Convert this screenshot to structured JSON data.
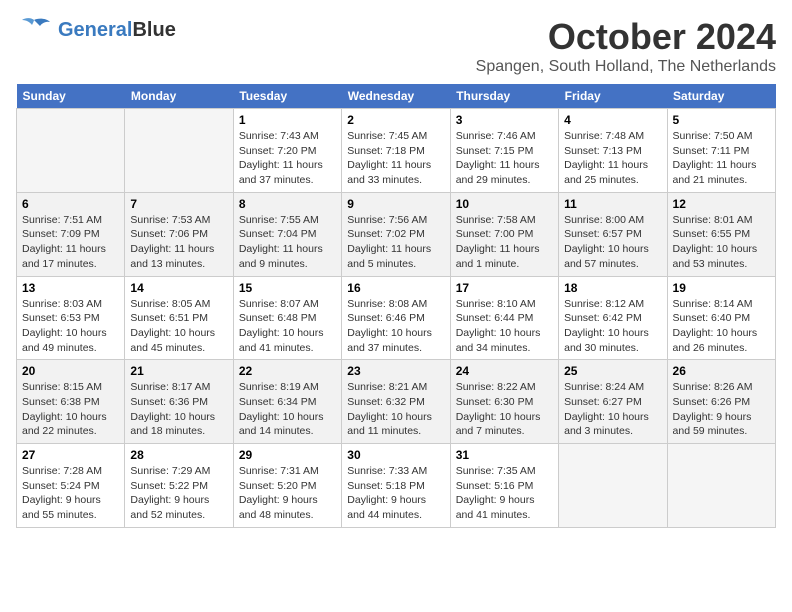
{
  "logo": {
    "part1": "General",
    "part2": "Blue"
  },
  "title": "October 2024",
  "location": "Spangen, South Holland, The Netherlands",
  "weekdays": [
    "Sunday",
    "Monday",
    "Tuesday",
    "Wednesday",
    "Thursday",
    "Friday",
    "Saturday"
  ],
  "weeks": [
    [
      {
        "day": "",
        "sunrise": "",
        "sunset": "",
        "daylight": ""
      },
      {
        "day": "",
        "sunrise": "",
        "sunset": "",
        "daylight": ""
      },
      {
        "day": "1",
        "sunrise": "Sunrise: 7:43 AM",
        "sunset": "Sunset: 7:20 PM",
        "daylight": "Daylight: 11 hours and 37 minutes."
      },
      {
        "day": "2",
        "sunrise": "Sunrise: 7:45 AM",
        "sunset": "Sunset: 7:18 PM",
        "daylight": "Daylight: 11 hours and 33 minutes."
      },
      {
        "day": "3",
        "sunrise": "Sunrise: 7:46 AM",
        "sunset": "Sunset: 7:15 PM",
        "daylight": "Daylight: 11 hours and 29 minutes."
      },
      {
        "day": "4",
        "sunrise": "Sunrise: 7:48 AM",
        "sunset": "Sunset: 7:13 PM",
        "daylight": "Daylight: 11 hours and 25 minutes."
      },
      {
        "day": "5",
        "sunrise": "Sunrise: 7:50 AM",
        "sunset": "Sunset: 7:11 PM",
        "daylight": "Daylight: 11 hours and 21 minutes."
      }
    ],
    [
      {
        "day": "6",
        "sunrise": "Sunrise: 7:51 AM",
        "sunset": "Sunset: 7:09 PM",
        "daylight": "Daylight: 11 hours and 17 minutes."
      },
      {
        "day": "7",
        "sunrise": "Sunrise: 7:53 AM",
        "sunset": "Sunset: 7:06 PM",
        "daylight": "Daylight: 11 hours and 13 minutes."
      },
      {
        "day": "8",
        "sunrise": "Sunrise: 7:55 AM",
        "sunset": "Sunset: 7:04 PM",
        "daylight": "Daylight: 11 hours and 9 minutes."
      },
      {
        "day": "9",
        "sunrise": "Sunrise: 7:56 AM",
        "sunset": "Sunset: 7:02 PM",
        "daylight": "Daylight: 11 hours and 5 minutes."
      },
      {
        "day": "10",
        "sunrise": "Sunrise: 7:58 AM",
        "sunset": "Sunset: 7:00 PM",
        "daylight": "Daylight: 11 hours and 1 minute."
      },
      {
        "day": "11",
        "sunrise": "Sunrise: 8:00 AM",
        "sunset": "Sunset: 6:57 PM",
        "daylight": "Daylight: 10 hours and 57 minutes."
      },
      {
        "day": "12",
        "sunrise": "Sunrise: 8:01 AM",
        "sunset": "Sunset: 6:55 PM",
        "daylight": "Daylight: 10 hours and 53 minutes."
      }
    ],
    [
      {
        "day": "13",
        "sunrise": "Sunrise: 8:03 AM",
        "sunset": "Sunset: 6:53 PM",
        "daylight": "Daylight: 10 hours and 49 minutes."
      },
      {
        "day": "14",
        "sunrise": "Sunrise: 8:05 AM",
        "sunset": "Sunset: 6:51 PM",
        "daylight": "Daylight: 10 hours and 45 minutes."
      },
      {
        "day": "15",
        "sunrise": "Sunrise: 8:07 AM",
        "sunset": "Sunset: 6:48 PM",
        "daylight": "Daylight: 10 hours and 41 minutes."
      },
      {
        "day": "16",
        "sunrise": "Sunrise: 8:08 AM",
        "sunset": "Sunset: 6:46 PM",
        "daylight": "Daylight: 10 hours and 37 minutes."
      },
      {
        "day": "17",
        "sunrise": "Sunrise: 8:10 AM",
        "sunset": "Sunset: 6:44 PM",
        "daylight": "Daylight: 10 hours and 34 minutes."
      },
      {
        "day": "18",
        "sunrise": "Sunrise: 8:12 AM",
        "sunset": "Sunset: 6:42 PM",
        "daylight": "Daylight: 10 hours and 30 minutes."
      },
      {
        "day": "19",
        "sunrise": "Sunrise: 8:14 AM",
        "sunset": "Sunset: 6:40 PM",
        "daylight": "Daylight: 10 hours and 26 minutes."
      }
    ],
    [
      {
        "day": "20",
        "sunrise": "Sunrise: 8:15 AM",
        "sunset": "Sunset: 6:38 PM",
        "daylight": "Daylight: 10 hours and 22 minutes."
      },
      {
        "day": "21",
        "sunrise": "Sunrise: 8:17 AM",
        "sunset": "Sunset: 6:36 PM",
        "daylight": "Daylight: 10 hours and 18 minutes."
      },
      {
        "day": "22",
        "sunrise": "Sunrise: 8:19 AM",
        "sunset": "Sunset: 6:34 PM",
        "daylight": "Daylight: 10 hours and 14 minutes."
      },
      {
        "day": "23",
        "sunrise": "Sunrise: 8:21 AM",
        "sunset": "Sunset: 6:32 PM",
        "daylight": "Daylight: 10 hours and 11 minutes."
      },
      {
        "day": "24",
        "sunrise": "Sunrise: 8:22 AM",
        "sunset": "Sunset: 6:30 PM",
        "daylight": "Daylight: 10 hours and 7 minutes."
      },
      {
        "day": "25",
        "sunrise": "Sunrise: 8:24 AM",
        "sunset": "Sunset: 6:27 PM",
        "daylight": "Daylight: 10 hours and 3 minutes."
      },
      {
        "day": "26",
        "sunrise": "Sunrise: 8:26 AM",
        "sunset": "Sunset: 6:26 PM",
        "daylight": "Daylight: 9 hours and 59 minutes."
      }
    ],
    [
      {
        "day": "27",
        "sunrise": "Sunrise: 7:28 AM",
        "sunset": "Sunset: 5:24 PM",
        "daylight": "Daylight: 9 hours and 55 minutes."
      },
      {
        "day": "28",
        "sunrise": "Sunrise: 7:29 AM",
        "sunset": "Sunset: 5:22 PM",
        "daylight": "Daylight: 9 hours and 52 minutes."
      },
      {
        "day": "29",
        "sunrise": "Sunrise: 7:31 AM",
        "sunset": "Sunset: 5:20 PM",
        "daylight": "Daylight: 9 hours and 48 minutes."
      },
      {
        "day": "30",
        "sunrise": "Sunrise: 7:33 AM",
        "sunset": "Sunset: 5:18 PM",
        "daylight": "Daylight: 9 hours and 44 minutes."
      },
      {
        "day": "31",
        "sunrise": "Sunrise: 7:35 AM",
        "sunset": "Sunset: 5:16 PM",
        "daylight": "Daylight: 9 hours and 41 minutes."
      },
      {
        "day": "",
        "sunrise": "",
        "sunset": "",
        "daylight": ""
      },
      {
        "day": "",
        "sunrise": "",
        "sunset": "",
        "daylight": ""
      }
    ]
  ]
}
